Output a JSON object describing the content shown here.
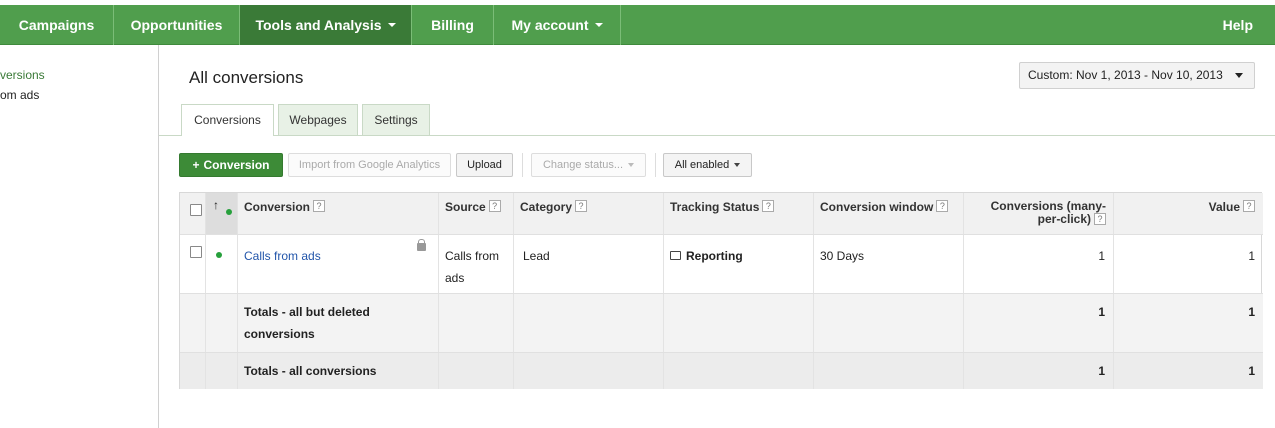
{
  "nav": {
    "items": [
      "Campaigns",
      "Opportunities",
      "Tools and Analysis",
      "Billing",
      "My account"
    ],
    "active": "Tools and Analysis",
    "help": "Help"
  },
  "sidebar": {
    "items": [
      "versions",
      "om ads"
    ]
  },
  "page": {
    "title": "All conversions",
    "date_range": "Custom: Nov 1, 2013 - Nov 10, 2013"
  },
  "tabs": [
    "Conversions",
    "Webpages",
    "Settings"
  ],
  "toolbar": {
    "add_label": "Conversion",
    "import_label": "Import from Google Analytics",
    "upload_label": "Upload",
    "change_status_label": "Change status...",
    "filter_label": "All enabled"
  },
  "table": {
    "headers": {
      "sort": "↑",
      "conversion": "Conversion",
      "source": "Source",
      "category": "Category",
      "tracking_status": "Tracking Status",
      "conversion_window": "Conversion window",
      "conversions_mpc": "Conversions (many-per-click)",
      "value": "Value"
    },
    "help_glyph": "?",
    "rows": [
      {
        "conversion": "Calls from ads",
        "source": "Calls from ads",
        "category": "Lead",
        "tracking_status": "Reporting",
        "conversion_window": "30 Days",
        "conversions_mpc": "1",
        "value": "1"
      }
    ],
    "totals": [
      {
        "label": "Totals - all but deleted conversions",
        "conversions_mpc": "1",
        "value": "1"
      },
      {
        "label": "Totals - all conversions",
        "conversions_mpc": "1",
        "value": "1"
      }
    ]
  },
  "colors": {
    "nav_bg": "#509e4d",
    "nav_active": "#3a7a37",
    "status_dot": "#27a03c",
    "link": "#2255aa"
  }
}
